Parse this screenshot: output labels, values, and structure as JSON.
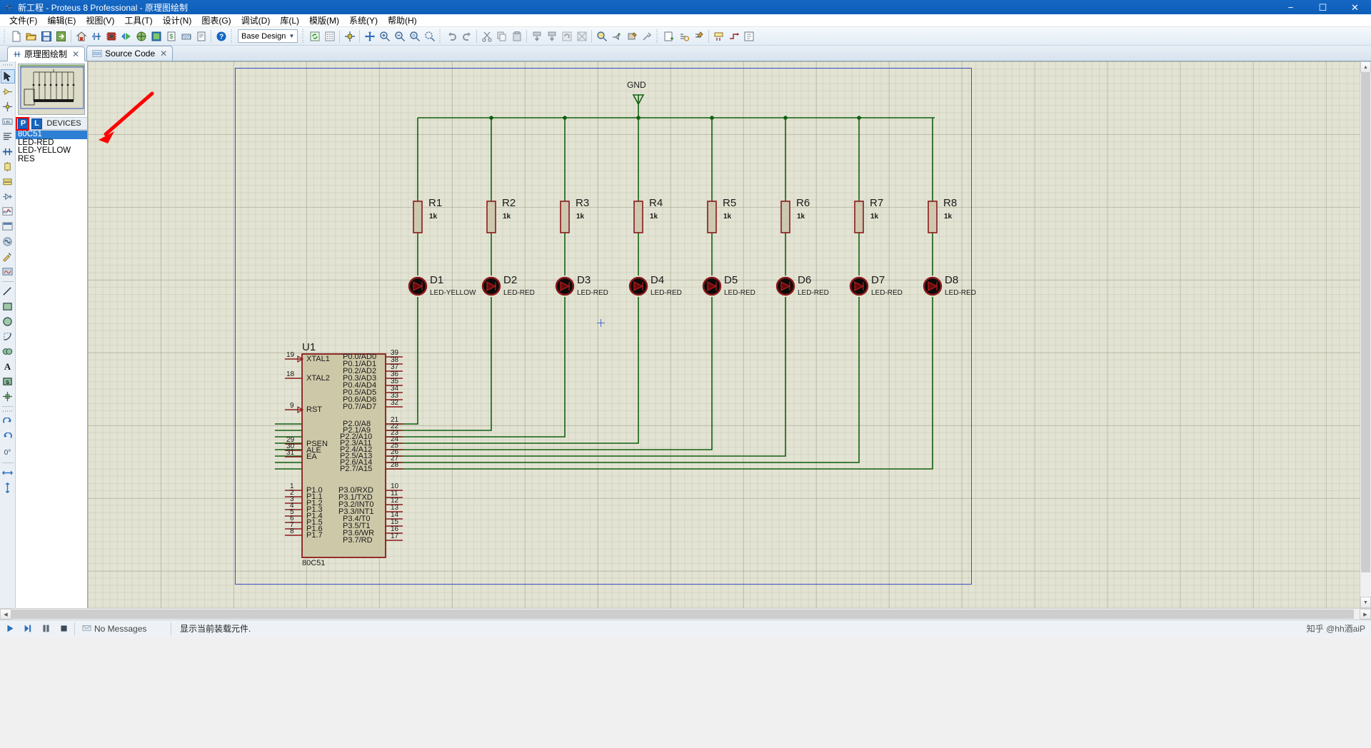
{
  "window": {
    "title": "新工程 - Proteus 8 Professional - 原理图绘制",
    "icon": "proteus-logo-icon",
    "minimize": "−",
    "maximize": "☐",
    "close": "✕"
  },
  "menubar": {
    "items": [
      {
        "label": "文件(F)",
        "name": "menu-file"
      },
      {
        "label": "编辑(E)",
        "name": "menu-edit"
      },
      {
        "label": "视图(V)",
        "name": "menu-view"
      },
      {
        "label": "工具(T)",
        "name": "menu-tools"
      },
      {
        "label": "设计(N)",
        "name": "menu-design"
      },
      {
        "label": "图表(G)",
        "name": "menu-graph"
      },
      {
        "label": "调试(D)",
        "name": "menu-debug"
      },
      {
        "label": "库(L)",
        "name": "menu-library"
      },
      {
        "label": "模版(M)",
        "name": "menu-template"
      },
      {
        "label": "系统(Y)",
        "name": "menu-system"
      },
      {
        "label": "帮助(H)",
        "name": "menu-help"
      }
    ]
  },
  "toolbar": {
    "design_combo_value": "Base Design",
    "icons": [
      "new-file-icon",
      "open-folder-icon",
      "save-icon",
      "save-as-icon",
      "home-icon",
      "schematic-capture-icon",
      "pcb-layout-icon",
      "3d-view-icon",
      "gerber-view-icon",
      "bill-of-materials-icon",
      "design-explorer-icon",
      "project-notes-icon",
      "help-icon",
      "refresh-icon",
      "toggle-grid-icon",
      "origin-icon",
      "pan-icon",
      "zoom-in-icon",
      "zoom-out-icon",
      "zoom-area-icon",
      "zoom-all-icon",
      "undo-icon",
      "redo-icon",
      "cut-icon",
      "copy-icon",
      "paste-icon",
      "block-copy-icon",
      "block-move-icon",
      "block-rotate-icon",
      "block-delete-icon",
      "pick-device-icon",
      "make-device-icon",
      "packaging-tool-icon",
      "decompose-icon",
      "wire-label-icon",
      "auto-wire-icon",
      "search-tag-icon",
      "property-assign-icon",
      "design-explorer2-icon",
      "new-sheet-icon",
      "remove-sheet-icon",
      "exit-sheet-icon",
      "bom-report-icon"
    ]
  },
  "tabs": [
    {
      "label": "原理图绘制",
      "icon": "schematic-icon",
      "active": true,
      "close": "✕"
    },
    {
      "label": "Source Code",
      "icon": "source-code-icon",
      "active": false,
      "close": "✕"
    }
  ],
  "left_rail": {
    "tools": [
      {
        "name": "selection-mode-icon",
        "selected": true
      },
      {
        "name": "component-mode-icon",
        "selected": false
      },
      {
        "name": "junction-dot-mode-icon",
        "selected": false
      },
      {
        "name": "wire-label-mode-icon",
        "selected": false
      },
      {
        "name": "text-script-mode-icon",
        "selected": false
      },
      {
        "name": "buses-mode-icon",
        "selected": false
      },
      {
        "name": "subcircuit-mode-icon",
        "selected": false
      },
      {
        "name": "terminals-mode-icon",
        "selected": false
      },
      {
        "name": "device-pins-mode-icon",
        "selected": false
      },
      {
        "name": "graph-mode-icon",
        "selected": false
      },
      {
        "name": "tape-recorder-mode-icon",
        "selected": false
      },
      {
        "name": "generator-mode-icon",
        "selected": false
      },
      {
        "name": "voltage-probe-mode-icon",
        "selected": false
      },
      {
        "name": "virtual-instruments-icon",
        "selected": false
      },
      {
        "name": "line-tool-icon",
        "selected": false
      },
      {
        "name": "box-tool-icon",
        "selected": false
      },
      {
        "name": "circle-tool-icon",
        "selected": false
      },
      {
        "name": "arc-tool-icon",
        "selected": false
      },
      {
        "name": "closed-path-tool-icon",
        "selected": false
      },
      {
        "name": "text-tool-icon",
        "selected": false
      },
      {
        "name": "symbol-tool-icon",
        "selected": false
      },
      {
        "name": "marker-tool-icon",
        "selected": false
      }
    ],
    "orientation": [
      {
        "name": "rotate-clockwise-icon",
        "label": ""
      },
      {
        "name": "rotate-counterclockwise-icon",
        "label": ""
      },
      {
        "name": "rotation-angle-field",
        "label": "0°"
      },
      {
        "name": "mirror-horizontal-icon",
        "label": ""
      },
      {
        "name": "mirror-vertical-icon",
        "label": ""
      }
    ]
  },
  "devices_panel": {
    "p_button": "P",
    "l_button": "L",
    "header": "DEVICES",
    "items": [
      {
        "label": "80C51",
        "selected": true
      },
      {
        "label": "LED-RED",
        "selected": false
      },
      {
        "label": "LED-YELLOW",
        "selected": false
      },
      {
        "label": "RES",
        "selected": false
      }
    ]
  },
  "statusbar": {
    "sim_buttons": [
      "play-icon",
      "step-icon",
      "pause-icon",
      "stop-icon"
    ],
    "no_messages": "No Messages",
    "message_icon": "message-icon",
    "status_text": "显示当前装载元件.",
    "watermark": "知乎 @hh酒aiP"
  },
  "schematic": {
    "gnd_label": "GND",
    "chip": {
      "ref": "U1",
      "part": "80C51",
      "left_pins": [
        {
          "num": "19",
          "label": "XTAL1"
        },
        {
          "num": "18",
          "label": "XTAL2"
        },
        {
          "num": "9",
          "label": "RST"
        },
        {
          "num": "29",
          "label": "PSEN"
        },
        {
          "num": "30",
          "label": "ALE"
        },
        {
          "num": "31",
          "label": "EA"
        },
        {
          "num": "1",
          "label": "P1.0"
        },
        {
          "num": "2",
          "label": "P1.1"
        },
        {
          "num": "3",
          "label": "P1.2"
        },
        {
          "num": "4",
          "label": "P1.3"
        },
        {
          "num": "5",
          "label": "P1.4"
        },
        {
          "num": "6",
          "label": "P1.5"
        },
        {
          "num": "7",
          "label": "P1.6"
        },
        {
          "num": "8",
          "label": "P1.7"
        }
      ],
      "right_pins": [
        {
          "num": "39",
          "label": "P0.0/AD0"
        },
        {
          "num": "38",
          "label": "P0.1/AD1"
        },
        {
          "num": "37",
          "label": "P0.2/AD2"
        },
        {
          "num": "36",
          "label": "P0.3/AD3"
        },
        {
          "num": "35",
          "label": "P0.4/AD4"
        },
        {
          "num": "34",
          "label": "P0.5/AD5"
        },
        {
          "num": "33",
          "label": "P0.6/AD6"
        },
        {
          "num": "32",
          "label": "P0.7/AD7"
        },
        {
          "num": "21",
          "label": "P2.0/A8"
        },
        {
          "num": "22",
          "label": "P2.1/A9"
        },
        {
          "num": "23",
          "label": "P2.2/A10"
        },
        {
          "num": "24",
          "label": "P2.3/A11"
        },
        {
          "num": "25",
          "label": "P2.4/A12"
        },
        {
          "num": "26",
          "label": "P2.5/A13"
        },
        {
          "num": "27",
          "label": "P2.6/A14"
        },
        {
          "num": "28",
          "label": "P2.7/A15"
        },
        {
          "num": "10",
          "label": "P3.0/RXD"
        },
        {
          "num": "11",
          "label": "P3.1/TXD"
        },
        {
          "num": "12",
          "label": "P3.2/INT0"
        },
        {
          "num": "13",
          "label": "P3.3/INT1"
        },
        {
          "num": "14",
          "label": "P3.4/T0"
        },
        {
          "num": "15",
          "label": "P3.5/T1"
        },
        {
          "num": "16",
          "label": "P3.6/WR"
        },
        {
          "num": "17",
          "label": "P3.7/RD"
        }
      ]
    },
    "resistors": [
      {
        "ref": "R1",
        "value": "1k"
      },
      {
        "ref": "R2",
        "value": "1k"
      },
      {
        "ref": "R3",
        "value": "1k"
      },
      {
        "ref": "R4",
        "value": "1k"
      },
      {
        "ref": "R5",
        "value": "1k"
      },
      {
        "ref": "R6",
        "value": "1k"
      },
      {
        "ref": "R7",
        "value": "1k"
      },
      {
        "ref": "R8",
        "value": "1k"
      }
    ],
    "leds": [
      {
        "ref": "D1",
        "part": "LED-YELLOW"
      },
      {
        "ref": "D2",
        "part": "LED-RED"
      },
      {
        "ref": "D3",
        "part": "LED-RED"
      },
      {
        "ref": "D4",
        "part": "LED-RED"
      },
      {
        "ref": "D5",
        "part": "LED-RED"
      },
      {
        "ref": "D6",
        "part": "LED-RED"
      },
      {
        "ref": "D7",
        "part": "LED-RED"
      },
      {
        "ref": "D8",
        "part": "LED-RED"
      }
    ]
  },
  "colors": {
    "title_blue": "#0d5eb8",
    "canvas_bg": "#e3e3d3",
    "wire_green": "#106010",
    "component_red": "#8b1a1a",
    "chip_fill": "#cdc8a8",
    "sheet_border": "#3a52c6",
    "select_blue": "#2d7fd4"
  }
}
